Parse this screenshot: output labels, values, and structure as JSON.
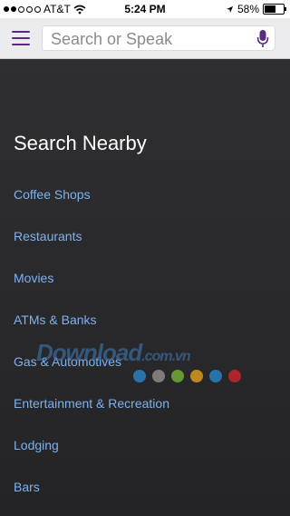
{
  "status_bar": {
    "carrier": "AT&T",
    "time": "5:24 PM",
    "battery": "58%"
  },
  "header": {
    "search_placeholder": "Search or Speak"
  },
  "main": {
    "title": "Search Nearby",
    "items": [
      "Coffee Shops",
      "Restaurants",
      "Movies",
      "ATMs & Banks",
      "Gas & Automotives",
      "Entertainment & Recreation",
      "Lodging",
      "Bars"
    ]
  },
  "watermark": {
    "text": "Download",
    "suffix": ".com.vn"
  },
  "colors": {
    "accent": "#5b2a86",
    "link": "#7db1ee",
    "background": "#2a2a2c"
  },
  "icons": [
    "signal-dots",
    "wifi-icon",
    "location-arrow-icon",
    "battery-icon",
    "menu-icon",
    "microphone-icon"
  ]
}
